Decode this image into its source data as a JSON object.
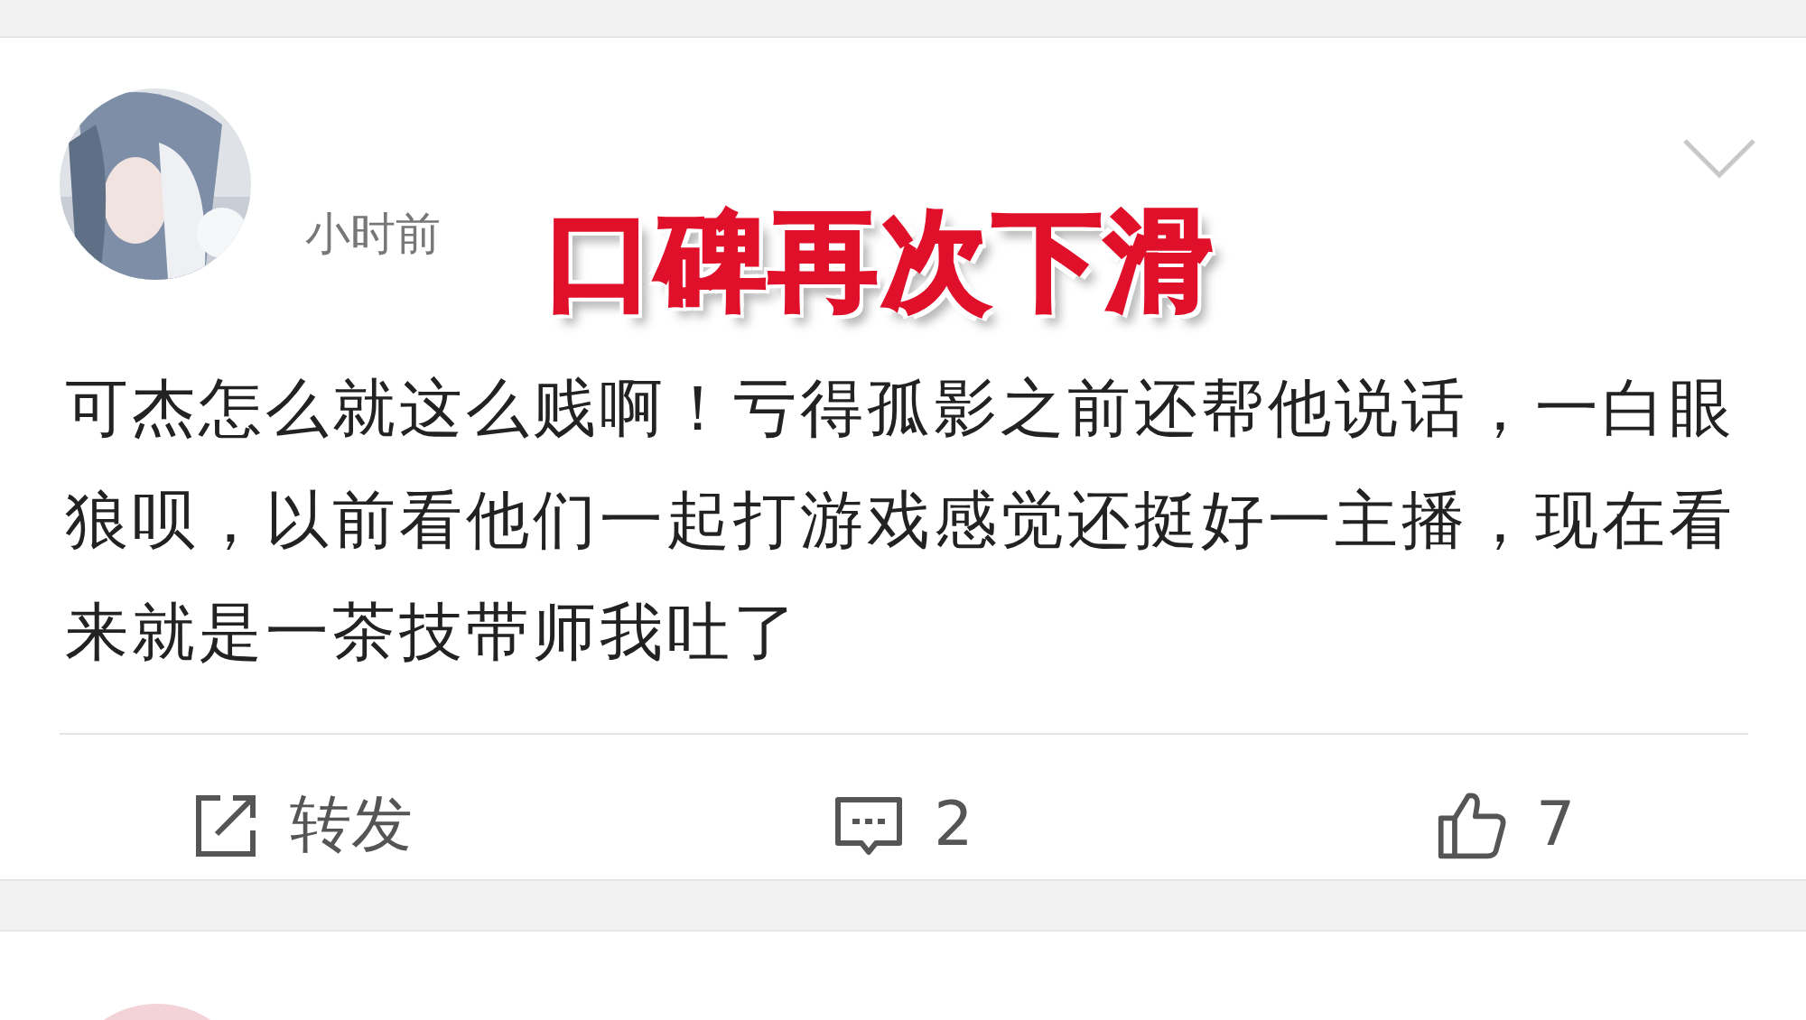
{
  "post": {
    "time": "小时前",
    "body": "可杰怎么就这么贱啊！亏得孤影之前还帮他说话，一白眼狼呗，以前看他们一起打游戏感觉还挺好一主播，现在看来就是一茶技带师我吐了",
    "actions": [
      {
        "kind": "repost",
        "label": "转发"
      },
      {
        "kind": "comment",
        "label": "2"
      },
      {
        "kind": "like",
        "label": "7"
      }
    ]
  },
  "overlay_caption": "口碑再次下滑"
}
